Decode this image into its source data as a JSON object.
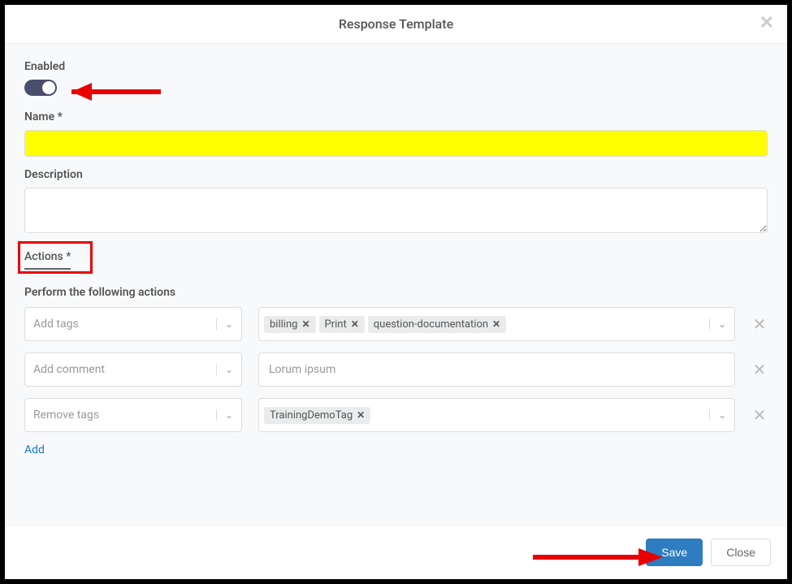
{
  "header": {
    "title": "Response Template",
    "close_icon": "✕"
  },
  "form": {
    "enabled_label": "Enabled",
    "enabled_value": true,
    "name_label": "Name *",
    "name_value": "",
    "desc_label": "Description",
    "desc_value": ""
  },
  "actions": {
    "tab_label": "Actions *",
    "subheading": "Perform the following actions",
    "rows": [
      {
        "type": "Add tags",
        "tags": [
          "billing",
          "Print",
          "question-documentation"
        ]
      },
      {
        "type": "Add comment",
        "value": "Lorum ipsum"
      },
      {
        "type": "Remove tags",
        "tags": [
          "TrainingDemoTag"
        ]
      }
    ],
    "add_label": "Add"
  },
  "footer": {
    "save_label": "Save",
    "close_label": "Close"
  }
}
